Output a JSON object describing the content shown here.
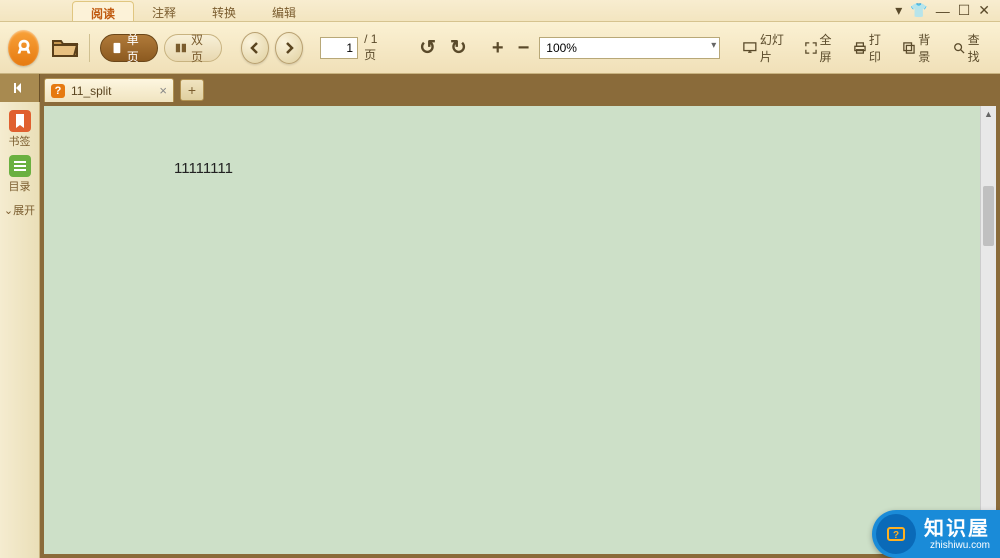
{
  "menu": {
    "tabs": [
      "阅读",
      "注释",
      "转换",
      "编辑"
    ],
    "active": 0
  },
  "toolbar": {
    "single_page": "单页",
    "double_page": "双页",
    "page_current": "1",
    "page_total": "/ 1页",
    "zoom": "100%",
    "slideshow": "幻灯片",
    "fullscreen": "全屏",
    "print": "打印",
    "background": "背景",
    "find": "查找"
  },
  "doctab": {
    "title": "11_split"
  },
  "sidebar": {
    "bookmark": "书签",
    "toc": "目录",
    "expand": "展开"
  },
  "document": {
    "text": "11111111"
  },
  "watermark": {
    "title": "知识屋",
    "url": "zhishiwu.com"
  }
}
